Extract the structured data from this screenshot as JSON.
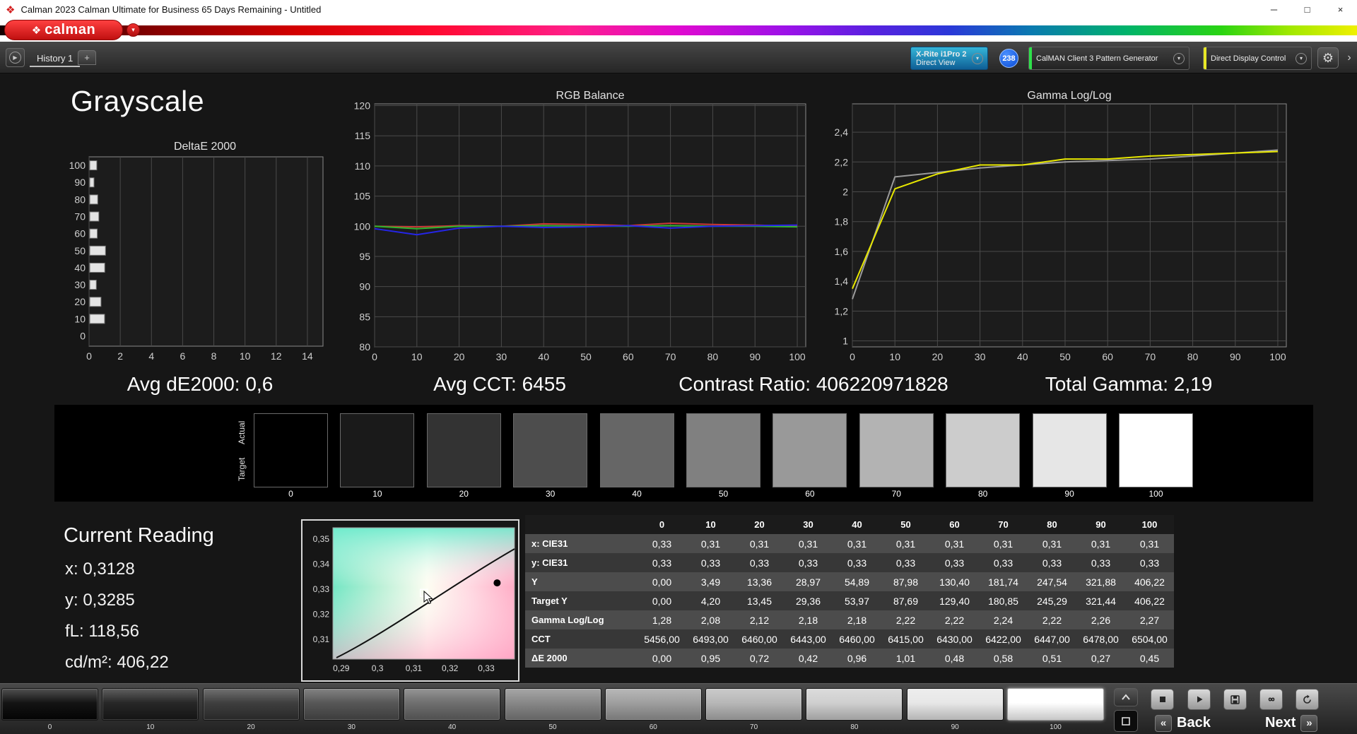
{
  "window": {
    "title": "Calman 2023 Calman Ultimate for Business 65 Days Remaining  - Untitled",
    "minimize": "─",
    "restore": "□",
    "close": "×"
  },
  "brand": {
    "name": "calman",
    "diamond": "❖",
    "dropdown_glyph": "▾"
  },
  "toolbar": {
    "panel_toggle_glyph": "▶",
    "history_tab": "History 1",
    "add_tab": "+",
    "meter": {
      "line1": "X-Rite i1Pro 2",
      "line2": "Direct View",
      "chevron": "▾"
    },
    "badge": "238",
    "pattern_generator": "CalMAN Client 3 Pattern Generator",
    "display_control": "Direct Display Control",
    "settings_glyph": "⚙",
    "more_glyph": "›"
  },
  "page_title": "Grayscale",
  "stats": [
    "Avg dE2000: 0,6",
    "Avg CCT: 6455",
    "Contrast Ratio: 406220971828",
    "Total Gamma: 2,19"
  ],
  "swatch_panel": {
    "row_labels": [
      "Actual",
      "Target"
    ],
    "levels": [
      "0",
      "10",
      "20",
      "30",
      "40",
      "50",
      "60",
      "70",
      "80",
      "90",
      "100"
    ],
    "colors": [
      "#000000",
      "#1a1a1a",
      "#333333",
      "#4d4d4d",
      "#666666",
      "#808080",
      "#999999",
      "#b3b3b3",
      "#cccccc",
      "#e6e6e6",
      "#ffffff"
    ]
  },
  "current_reading": {
    "title": "Current Reading",
    "lines": [
      "x: 0,3128",
      "y: 0,3285",
      "fL: 118,56",
      "cd/m²: 406,22"
    ]
  },
  "table": {
    "header": [
      "",
      "0",
      "10",
      "20",
      "30",
      "40",
      "50",
      "60",
      "70",
      "80",
      "90",
      "100"
    ],
    "rows": [
      {
        "label": "x: CIE31",
        "values": [
          "0,33",
          "0,31",
          "0,31",
          "0,31",
          "0,31",
          "0,31",
          "0,31",
          "0,31",
          "0,31",
          "0,31",
          "0,31"
        ]
      },
      {
        "label": "y: CIE31",
        "values": [
          "0,33",
          "0,33",
          "0,33",
          "0,33",
          "0,33",
          "0,33",
          "0,33",
          "0,33",
          "0,33",
          "0,33",
          "0,33"
        ]
      },
      {
        "label": "Y",
        "values": [
          "0,00",
          "3,49",
          "13,36",
          "28,97",
          "54,89",
          "87,98",
          "130,40",
          "181,74",
          "247,54",
          "321,88",
          "406,22"
        ]
      },
      {
        "label": "Target Y",
        "values": [
          "0,00",
          "4,20",
          "13,45",
          "29,36",
          "53,97",
          "87,69",
          "129,40",
          "180,85",
          "245,29",
          "321,44",
          "406,22"
        ]
      },
      {
        "label": "Gamma Log/Log",
        "values": [
          "1,28",
          "2,08",
          "2,12",
          "2,18",
          "2,18",
          "2,22",
          "2,22",
          "2,24",
          "2,22",
          "2,26",
          "2,27"
        ]
      },
      {
        "label": "CCT",
        "values": [
          "5456,00",
          "6493,00",
          "6460,00",
          "6443,00",
          "6460,00",
          "6415,00",
          "6430,00",
          "6422,00",
          "6447,00",
          "6478,00",
          "6504,00"
        ]
      },
      {
        "label": "ΔE 2000",
        "values": [
          "0,00",
          "0,95",
          "0,72",
          "0,42",
          "0,96",
          "1,01",
          "0,48",
          "0,58",
          "0,51",
          "0,27",
          "0,45"
        ]
      }
    ]
  },
  "bottom": {
    "patches": [
      {
        "label": "0",
        "color": "#050505"
      },
      {
        "label": "10",
        "color": "#1a1a1a"
      },
      {
        "label": "20",
        "color": "#333333"
      },
      {
        "label": "30",
        "color": "#4d4d4d"
      },
      {
        "label": "40",
        "color": "#666666"
      },
      {
        "label": "50",
        "color": "#808080"
      },
      {
        "label": "60",
        "color": "#999999"
      },
      {
        "label": "70",
        "color": "#b3b3b3"
      },
      {
        "label": "80",
        "color": "#cccccc"
      },
      {
        "label": "90",
        "color": "#e6e6e6"
      },
      {
        "label": "100",
        "color": "#ffffff",
        "active": true
      }
    ],
    "back": "Back",
    "next": "Next"
  },
  "chart_data": [
    {
      "id": "deltae",
      "type": "bar",
      "orientation": "horizontal",
      "title": "DeltaE 2000",
      "categories": [
        0,
        10,
        20,
        30,
        40,
        50,
        60,
        70,
        80,
        90,
        100
      ],
      "values": [
        0.0,
        0.95,
        0.72,
        0.42,
        0.96,
        1.01,
        0.48,
        0.58,
        0.51,
        0.27,
        0.45
      ],
      "xlim": [
        0,
        15
      ],
      "xticks": [
        0,
        2,
        4,
        6,
        8,
        10,
        12,
        14
      ],
      "ylim": [
        -6,
        105
      ],
      "bar_color": "#e4e4e4",
      "grid": true,
      "legend": "none"
    },
    {
      "id": "rgb",
      "type": "line",
      "title": "RGB Balance",
      "x": [
        0,
        10,
        20,
        30,
        40,
        50,
        60,
        70,
        80,
        90,
        100
      ],
      "xlim": [
        0,
        102
      ],
      "xticks": [
        0,
        10,
        20,
        30,
        40,
        50,
        60,
        70,
        80,
        90,
        100
      ],
      "ylim": [
        80,
        120.3
      ],
      "yticks": [
        80,
        85,
        90,
        95,
        100,
        105,
        110,
        115,
        120
      ],
      "series": [
        {
          "name": "Red",
          "color": "#cc3838",
          "values": [
            100.0,
            99.9,
            100.1,
            100.0,
            100.4,
            100.3,
            100.1,
            100.5,
            100.3,
            100.2,
            100.0
          ]
        },
        {
          "name": "Green",
          "color": "#2fb52f",
          "values": [
            100.0,
            99.6,
            100.0,
            100.0,
            100.1,
            100.0,
            100.0,
            100.1,
            100.0,
            100.0,
            99.9
          ]
        },
        {
          "name": "Blue",
          "color": "#2525e8",
          "values": [
            99.6,
            98.6,
            99.7,
            100.0,
            99.8,
            99.9,
            100.1,
            99.7,
            100.0,
            100.1,
            100.2
          ]
        }
      ],
      "grid": true,
      "legend": "none"
    },
    {
      "id": "gamma",
      "type": "line",
      "title": "Gamma Log/Log",
      "x": [
        0,
        10,
        20,
        30,
        40,
        50,
        60,
        70,
        80,
        90,
        100
      ],
      "xlim": [
        0,
        102
      ],
      "xticks": [
        0,
        10,
        20,
        30,
        40,
        50,
        60,
        70,
        80,
        90,
        100
      ],
      "ylim": [
        0.96,
        2.59
      ],
      "yticks": [
        1,
        1.2,
        1.4,
        1.6,
        1.8,
        2,
        2.2,
        2.4
      ],
      "series": [
        {
          "name": "Target",
          "color": "#9b9b9b",
          "values": [
            1.28,
            2.1,
            2.13,
            2.16,
            2.18,
            2.2,
            2.21,
            2.22,
            2.24,
            2.26,
            2.28
          ]
        },
        {
          "name": "Measured",
          "color": "#e8e800",
          "values": [
            1.35,
            2.02,
            2.12,
            2.18,
            2.18,
            2.22,
            2.22,
            2.24,
            2.25,
            2.26,
            2.27
          ]
        }
      ],
      "grid": true,
      "legend": "none"
    },
    {
      "id": "cie",
      "type": "scatter",
      "title": "",
      "xlim": [
        0.2877,
        0.3378
      ],
      "ylim": [
        0.3021,
        0.3545
      ],
      "xticks": [
        0.29,
        0.3,
        0.31,
        0.32,
        0.33
      ],
      "yticks": [
        0.35,
        0.34,
        0.33,
        0.32,
        0.31
      ],
      "points": [
        {
          "name": "target-point",
          "x": 0.333,
          "y": 0.3325,
          "style": "black-dot"
        },
        {
          "name": "measured-point",
          "x": 0.3128,
          "y": 0.3285,
          "style": "white-square"
        }
      ]
    }
  ]
}
